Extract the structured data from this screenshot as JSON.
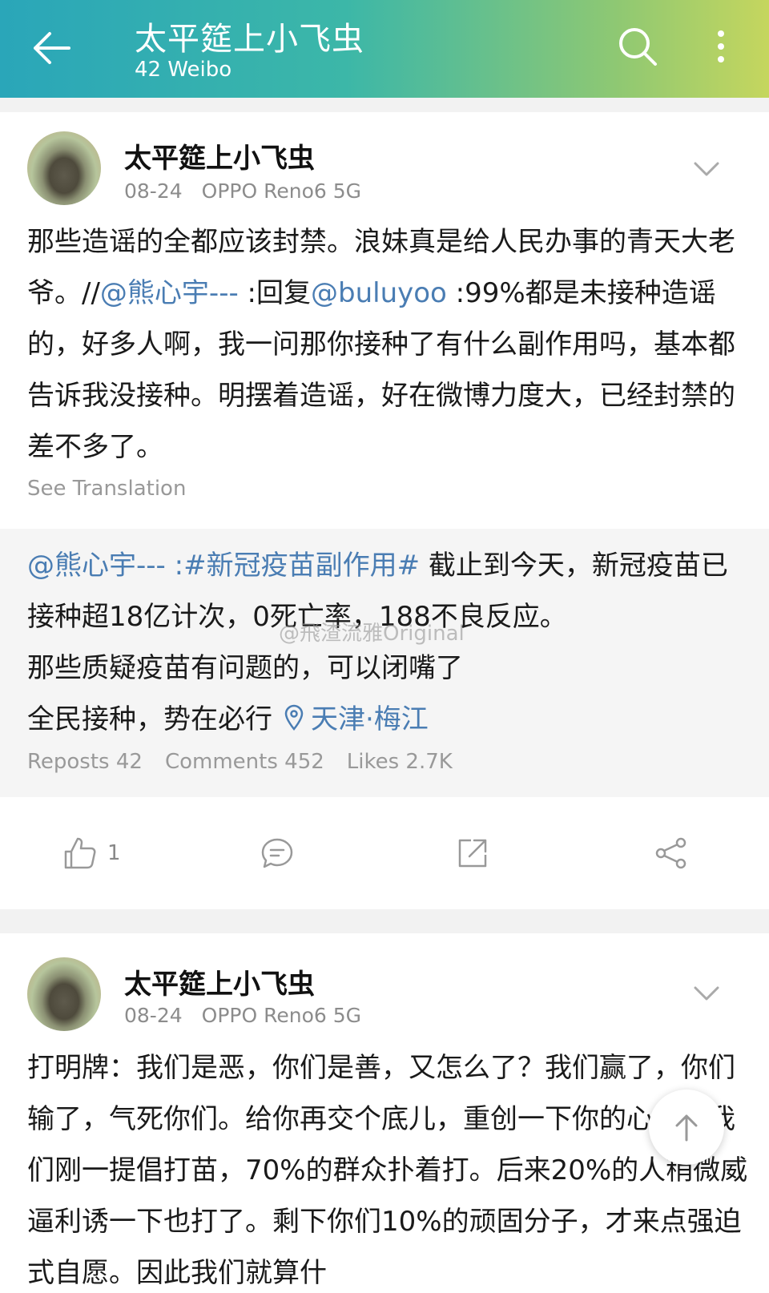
{
  "header": {
    "title": "太平筵上小飞虫",
    "subtitle": "42 Weibo"
  },
  "post1": {
    "author": "太平筵上小飞虫",
    "date": "08-24",
    "device": "OPPO Reno6 5G",
    "text_part1": "那些造谣的全都应该封禁。浪妹真是给人民办事的青天大老爷。//",
    "mention1": "@熊心宇---",
    "text_part2": " :回复",
    "mention2": "@buluyoo",
    "text_part3": " :99%都是未接种造谣的，好多人啊，我一问那你接种了有什么副作用吗，基本都告诉我没接种。明摆着造谣，好在微博力度大，已经封禁的差不多了。",
    "see_translation": "See Translation",
    "repost": {
      "mention": "@熊心宇---",
      "hashtag": " :#新冠疫苗副作用#",
      "line1": " 截止到今天，新冠疫苗已接种超18亿计次，0死亡率，188不良反应。",
      "line2": "那些质疑疫苗有问题的，可以闭嘴了",
      "line3": "全民接种，势在必行",
      "location": "天津·梅江",
      "watermark": "@飛渣流雅Original",
      "reposts": "Reposts 42",
      "comments": "Comments 452",
      "likes": "Likes 2.7K"
    },
    "like_count": "1"
  },
  "post2": {
    "author": "太平筵上小飞虫",
    "date": "08-24",
    "device": "OPPO Reno6 5G",
    "text": "打明牌：我们是恶，你们是善，又怎么了？我们赢了，你们输了，气死你们。给你再交个底儿，重创一下你的心灵。我们刚一提倡打苗，70%的群众扑着打。后来20%的人稍微威逼利诱一下也打了。剩下你们10%的顽固分子，才来点强迫式自愿。因此我们就算什"
  },
  "colors": {
    "link": "#4a7db3",
    "header_start": "#2aa6b9",
    "header_end": "#c5d65e"
  },
  "icons": [
    "back-arrow-icon",
    "search-icon",
    "more-vertical-icon",
    "chevron-down-icon",
    "location-icon",
    "like-icon",
    "comment-icon",
    "repost-icon",
    "share-icon",
    "arrow-up-icon"
  ]
}
